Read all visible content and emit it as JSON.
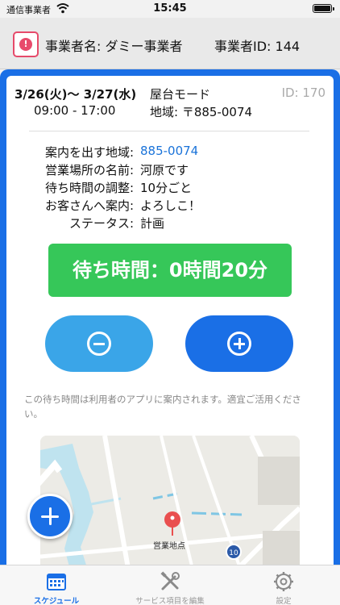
{
  "status_bar": {
    "carrier": "通信事業者",
    "time": "15:45"
  },
  "header": {
    "alert_glyph": "!",
    "business_name": "事業者名: ダミー事業者",
    "business_id": "事業者ID: 144"
  },
  "schedule": {
    "date_range": "3/26(火)〜 3/27(水)",
    "hours": "09:00 - 17:00",
    "mode": "屋台モード",
    "region": "地域: 〒885-0074",
    "id": "ID: 170"
  },
  "details": [
    {
      "label": "案内を出す地域:",
      "value": "885-0074",
      "link": true
    },
    {
      "label": "営業場所の名前:",
      "value": "河原です",
      "link": false
    },
    {
      "label": "待ち時間の調整:",
      "value": "10分ごと",
      "link": false
    },
    {
      "label": "お客さんへ案内:",
      "value": "よろしこ！",
      "link": false
    },
    {
      "label": "ステータス:",
      "value": "計画",
      "link": false
    }
  ],
  "wait_time": {
    "label": "待ち時間：0時間20分"
  },
  "note": "この待ち時間は利用者のアプリに案内されます。適宜ご活用ください。",
  "map": {
    "pin_label": "営業地点",
    "route_badge": "10"
  },
  "tabbar": {
    "items": [
      {
        "label": "スケジュール",
        "icon": "calendar-icon",
        "active": true
      },
      {
        "label": "サービス項目を編集",
        "icon": "tools-icon",
        "active": false
      },
      {
        "label": "設定",
        "icon": "gear-icon",
        "active": false
      }
    ]
  },
  "colors": {
    "accent": "#1a6fe6",
    "wait_banner": "#36c759",
    "minus_button": "#3aa5e8",
    "alert": "#e84a6c",
    "link": "#1a73d9"
  }
}
